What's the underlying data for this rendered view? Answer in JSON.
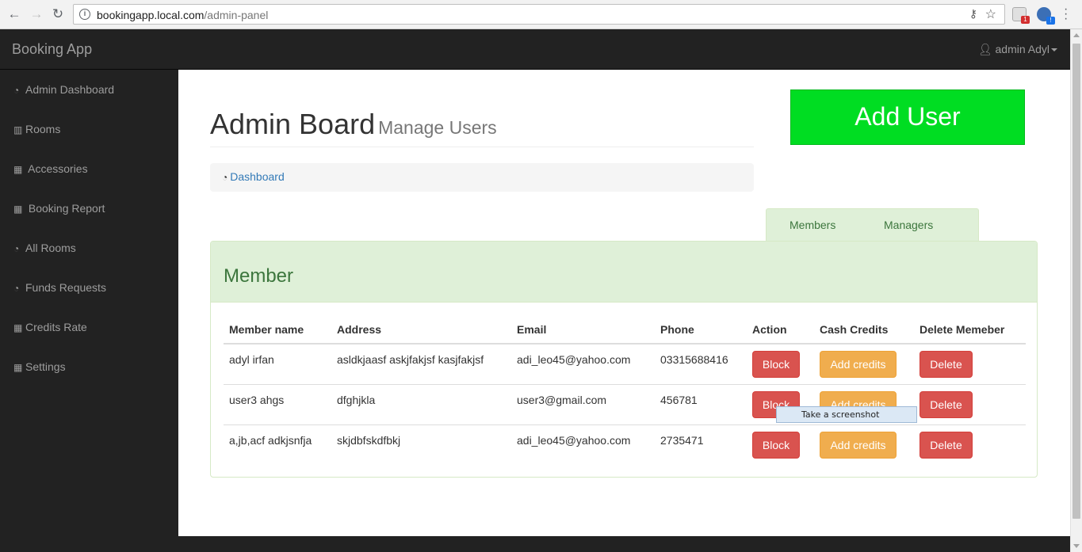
{
  "browser": {
    "url_host": "bookingapp.local.com",
    "url_path": "/admin-panel",
    "ext1_badge": "1",
    "ext2_badge": "!"
  },
  "navbar": {
    "brand": "Booking App",
    "user_label": "admin Adyl"
  },
  "sidebar": {
    "items": [
      {
        "label": "Admin Dashboard",
        "icon": "dashboard-icon",
        "glyph": "◔"
      },
      {
        "label": "Rooms",
        "icon": "bar-chart-icon",
        "glyph": "▥"
      },
      {
        "label": "Accessories",
        "icon": "table-icon",
        "glyph": "▦"
      },
      {
        "label": "Booking Report",
        "icon": "table-icon",
        "glyph": "▦"
      },
      {
        "label": "All Rooms",
        "icon": "dashboard-icon",
        "glyph": "◔"
      },
      {
        "label": "Funds Requests",
        "icon": "dashboard-icon",
        "glyph": "◔"
      },
      {
        "label": "Credits Rate",
        "icon": "table-icon",
        "glyph": "▦"
      },
      {
        "label": "Settings",
        "icon": "table-icon",
        "glyph": "▦"
      }
    ]
  },
  "header": {
    "title": "Admin Board",
    "subtitle": "Manage Users",
    "breadcrumb": "Dashboard"
  },
  "add_user_label": "Add User",
  "tabs": [
    "Members",
    "Managers"
  ],
  "panel": {
    "title": "Member",
    "columns": [
      "Member name",
      "Address",
      "Email",
      "Phone",
      "Action",
      "Cash Credits",
      "Delete Memeber"
    ],
    "rows": [
      {
        "name": "adyl irfan",
        "address": "asldkjaasf askjfakjsf kasjfakjsf",
        "email": "adi_leo45@yahoo.com",
        "phone": "03315688416"
      },
      {
        "name": "user3 ahgs",
        "address": "dfghjkla",
        "email": "user3@gmail.com",
        "phone": "456781"
      },
      {
        "name": "a,jb,acf adkjsnfja",
        "address": "skjdbfskdfbkj",
        "email": "adi_leo45@yahoo.com",
        "phone": "2735471"
      }
    ],
    "buttons": {
      "block": "Block",
      "credits": "Add credits",
      "delete": "Delete"
    }
  },
  "tooltip": "Take a screenshot",
  "colors": {
    "add_user": "#00dd22",
    "danger": "#d9534f",
    "warning": "#f0ad4e",
    "success_bg": "#dff0d8",
    "success_text": "#3c763d"
  }
}
